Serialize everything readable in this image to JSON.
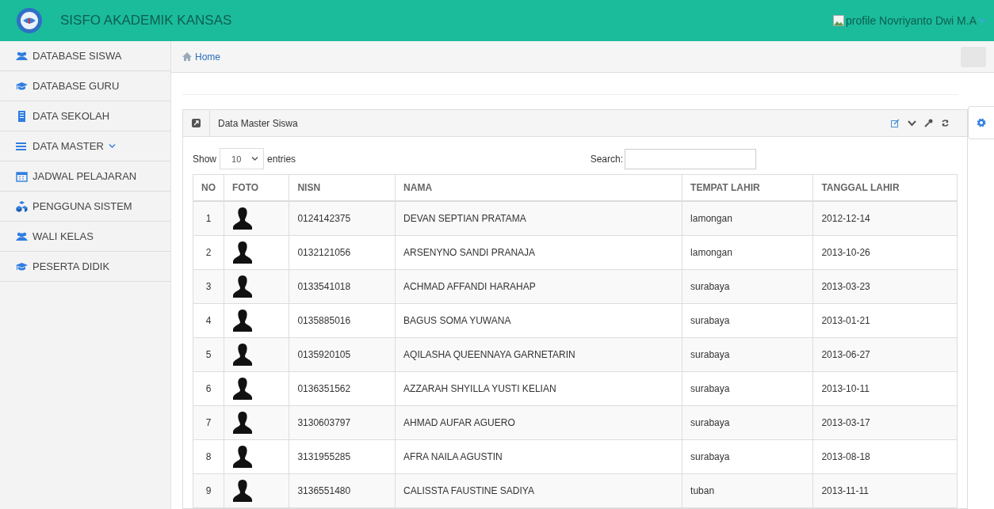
{
  "header": {
    "title": "SISFO AKADEMIK KANSAS",
    "user": "profile Novriyanto Dwi M.A"
  },
  "sidebar": {
    "items": [
      {
        "label": "DATABASE SISWA",
        "kind": "users",
        "has_submenu": false
      },
      {
        "label": "DATABASE GURU",
        "kind": "cap",
        "has_submenu": false
      },
      {
        "label": "DATA SEKOLAH",
        "kind": "building",
        "has_submenu": false
      },
      {
        "label": "DATA MASTER",
        "kind": "bars",
        "has_submenu": true
      },
      {
        "label": "JADWAL PELAJARAN",
        "kind": "calendar",
        "has_submenu": false
      },
      {
        "label": "PENGGUNA SISTEM",
        "kind": "cubes",
        "has_submenu": false
      },
      {
        "label": "WALI KELAS",
        "kind": "users",
        "has_submenu": false
      },
      {
        "label": "PESERTA DIDIK",
        "kind": "cap",
        "has_submenu": false
      }
    ]
  },
  "breadcrumb": {
    "home": "Home"
  },
  "panel": {
    "title": "Data Master Siswa",
    "length": {
      "before": "Show",
      "value": "10",
      "after": "entries"
    },
    "search": {
      "label": "Search:"
    },
    "table": {
      "columns": [
        "NO",
        "FOTO",
        "NISN",
        "NAMA",
        "TEMPAT LAHIR",
        "TANGGAL LAHIR"
      ],
      "rows": [
        {
          "no": "1",
          "nisn": "0124142375",
          "nama": "DEVAN SEPTIAN PRATAMA",
          "tempat": "lamongan",
          "tanggal": "2012-12-14"
        },
        {
          "no": "2",
          "nisn": "0132121056",
          "nama": "ARSENYNO SANDI PRANAJA",
          "tempat": "lamongan",
          "tanggal": "2013-10-26"
        },
        {
          "no": "3",
          "nisn": "0133541018",
          "nama": "ACHMAD AFFANDI HARAHAP",
          "tempat": "surabaya",
          "tanggal": "2013-03-23"
        },
        {
          "no": "4",
          "nisn": "0135885016",
          "nama": "BAGUS SOMA YUWANA",
          "tempat": "surabaya",
          "tanggal": "2013-01-21"
        },
        {
          "no": "5",
          "nisn": "0135920105",
          "nama": "AQILASHA QUEENNAYA GARNETARIN",
          "tempat": "surabaya",
          "tanggal": "2013-06-27"
        },
        {
          "no": "6",
          "nisn": "0136351562",
          "nama": "AZZARAH SHYILLA YUSTI KELIAN",
          "tempat": "surabaya",
          "tanggal": "2013-10-11"
        },
        {
          "no": "7",
          "nisn": "3130603797",
          "nama": "AHMAD AUFAR AGUERO",
          "tempat": "surabaya",
          "tanggal": "2013-03-17"
        },
        {
          "no": "8",
          "nisn": "3131955285",
          "nama": "AFRA NAILA AGUSTIN",
          "tempat": "surabaya",
          "tanggal": "2013-08-18"
        },
        {
          "no": "9",
          "nisn": "3136551480",
          "nama": "CALISSTA FAUSTINE SADIYA",
          "tempat": "tuban",
          "tanggal": "2013-11-11"
        }
      ]
    }
  }
}
